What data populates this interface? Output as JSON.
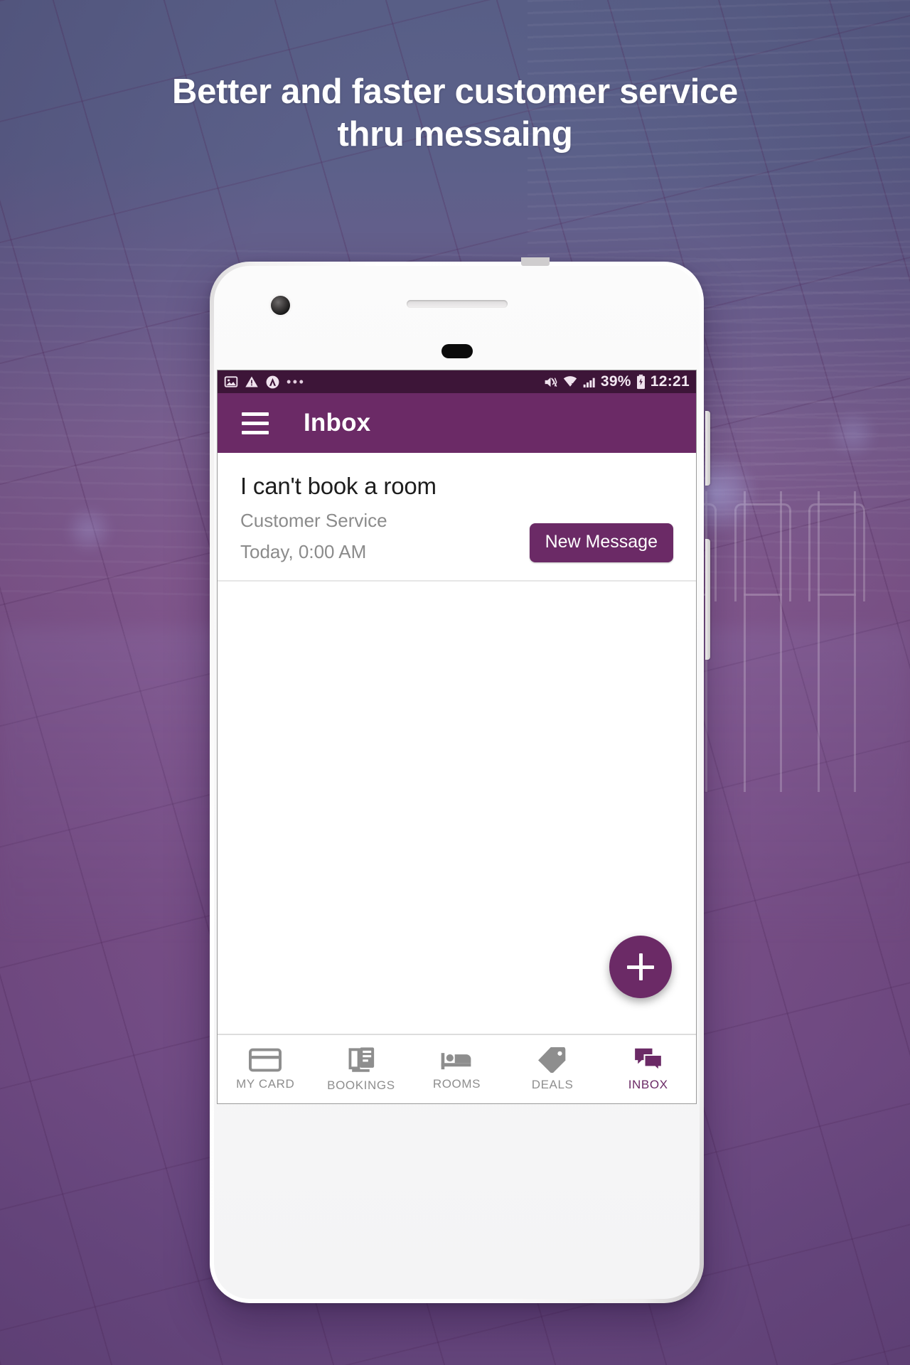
{
  "promo": {
    "headline": "Better and faster customer service\nthru messaing"
  },
  "colors": {
    "brand_purple": "#6b2a66",
    "statusbar_purple": "#3d1538",
    "bg_top": "#5a6188",
    "bg_bottom": "#6b4a82",
    "muted_text": "#8b8b8b"
  },
  "phone": {
    "statusbar": {
      "left_icons": [
        "image-icon",
        "warning-triangle-icon",
        "avast-shield-icon"
      ],
      "overflow_dots": "•••",
      "right_icons": [
        "mute-vibrate-icon",
        "wifi-icon",
        "signal-bars-icon",
        "battery-charging-icon"
      ],
      "battery_percent": "39%",
      "clock": "12:21"
    },
    "appbar": {
      "menu_icon": "hamburger-menu-icon",
      "title": "Inbox"
    },
    "inbox": {
      "messages": [
        {
          "subject": "I can't book a room",
          "sender": "Customer Service",
          "time": "Today, 0:00 AM",
          "action_label": "New Message"
        }
      ],
      "fab_label": "+",
      "fab_icon": "plus-icon"
    },
    "bottom_nav": [
      {
        "label": "MY CARD",
        "icon": "credit-card-icon",
        "active": false
      },
      {
        "label": "BOOKINGS",
        "icon": "documents-icon",
        "active": false
      },
      {
        "label": "ROOMS",
        "icon": "bed-icon",
        "active": false
      },
      {
        "label": "DEALS",
        "icon": "price-tag-icon",
        "active": false
      },
      {
        "label": "INBOX",
        "icon": "chat-bubbles-icon",
        "active": true
      }
    ]
  }
}
